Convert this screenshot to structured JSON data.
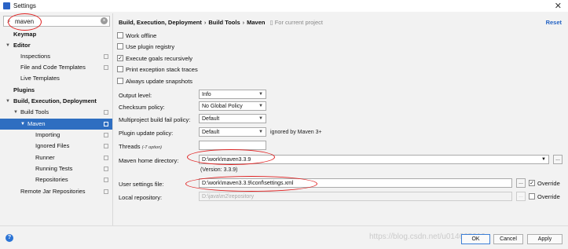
{
  "window": {
    "title": "Settings",
    "close_glyph": "✕"
  },
  "search": {
    "value": "maven",
    "icon": "search-icon",
    "clear_glyph": "×"
  },
  "sidebar": {
    "items": [
      {
        "label": "Keymap",
        "bold": true
      },
      {
        "label": "Editor",
        "bold": true,
        "arrow": "▼"
      },
      {
        "label": "Inspections"
      },
      {
        "label": "File and Code Templates"
      },
      {
        "label": "Live Templates"
      },
      {
        "label": "Plugins",
        "bold": true
      },
      {
        "label": "Build, Execution, Deployment",
        "bold": true,
        "arrow": "▼"
      },
      {
        "label": "Build Tools",
        "arrow": "▼"
      },
      {
        "label": "Maven",
        "arrow": "▼",
        "selected": true
      },
      {
        "label": "Importing"
      },
      {
        "label": "Ignored Files"
      },
      {
        "label": "Runner"
      },
      {
        "label": "Running Tests"
      },
      {
        "label": "Repositories"
      },
      {
        "label": "Remote Jar Repositories"
      }
    ]
  },
  "breadcrumb": {
    "part1": "Build, Execution, Deployment",
    "part2": "Build Tools",
    "part3": "Maven",
    "sep": "›",
    "scope": "For current project",
    "reset": "Reset"
  },
  "options": {
    "work_offline": "Work offline",
    "use_plugin_registry": "Use plugin registry",
    "execute_goals_recursively": "Execute goals recursively",
    "print_exception": "Print exception stack traces",
    "always_update_snapshots": "Always update snapshots",
    "execute_goals_checked": "✓"
  },
  "fields": {
    "output_level_label": "Output level:",
    "output_level_value": "Info",
    "checksum_label": "Checksum policy:",
    "checksum_value": "No Global Policy",
    "multiproject_label": "Multiproject build fail policy:",
    "multiproject_value": "Default",
    "plugin_update_label": "Plugin update policy:",
    "plugin_update_value": "Default",
    "plugin_update_note": "ignored by Maven 3+",
    "threads_label": "Threads",
    "threads_hint": "(-T option)",
    "threads_value": "",
    "maven_home_label": "Maven home directory:",
    "maven_home_value": "D:\\work\\maven3.3.9",
    "version": "(Version: 3.3.9)",
    "user_settings_label": "User settings file:",
    "user_settings_value": "D:\\work\\maven3.3.9\\conf\\settings.xml",
    "local_repo_label": "Local repository:",
    "local_repo_value": "D:\\java\\m2\\repository",
    "override_label": "Override",
    "override_checked": "✓",
    "caret": "▼",
    "dots": "..."
  },
  "buttons": {
    "help": "?",
    "ok": "OK",
    "cancel": "Cancel",
    "apply": "Apply"
  },
  "watermark": "https://blog.csdn.net/u014665019",
  "colors": {
    "selection": "#2e6ec1",
    "link": "#2463c4",
    "annotation": "#e02020"
  }
}
